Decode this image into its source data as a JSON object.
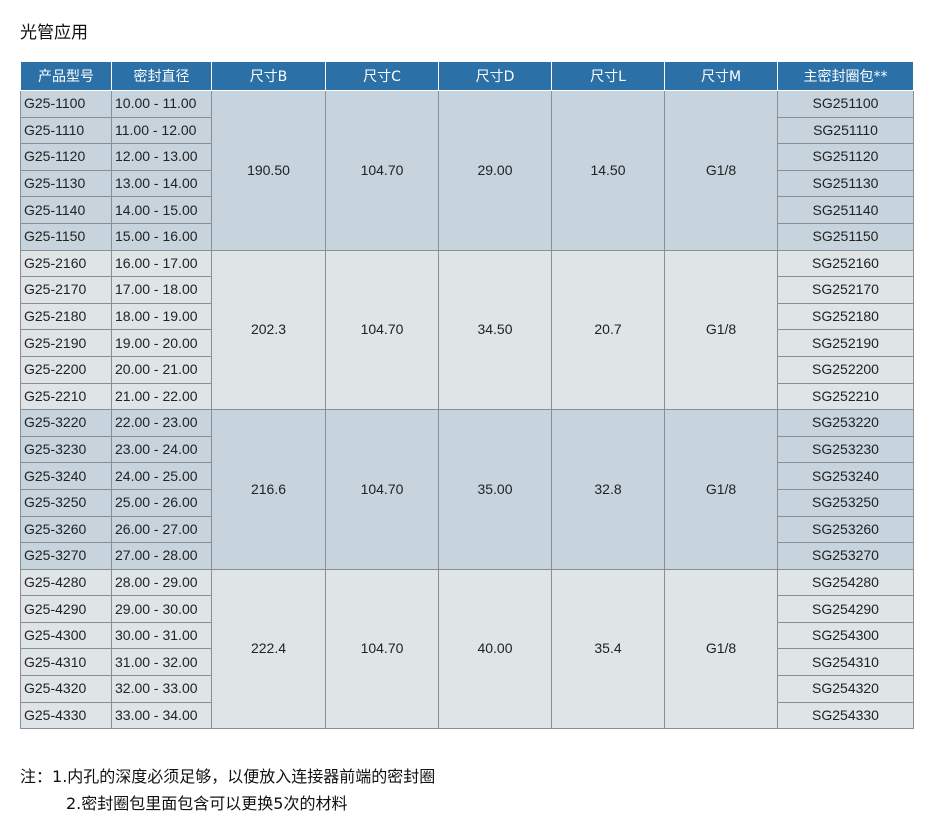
{
  "title": "光管应用",
  "headers": [
    "产品型号",
    "密封直径",
    "尺寸B",
    "尺寸C",
    "尺寸D",
    "尺寸L",
    "尺寸M",
    "主密封圈包**"
  ],
  "groups": [
    {
      "B": "190.50",
      "C": "104.70",
      "D": "29.00",
      "L": "14.50",
      "M": "G1/8",
      "rows": [
        {
          "model": "G25-1100",
          "range": "10.00 - 11.00",
          "seal": "SG251100"
        },
        {
          "model": "G25-1110",
          "range": "11.00 - 12.00",
          "seal": "SG251110"
        },
        {
          "model": "G25-1120",
          "range": "12.00 - 13.00",
          "seal": "SG251120"
        },
        {
          "model": "G25-1130",
          "range": "13.00 - 14.00",
          "seal": "SG251130"
        },
        {
          "model": "G25-1140",
          "range": "14.00 - 15.00",
          "seal": "SG251140"
        },
        {
          "model": "G25-1150",
          "range": "15.00 - 16.00",
          "seal": "SG251150"
        }
      ]
    },
    {
      "B": "202.3",
      "C": "104.70",
      "D": "34.50",
      "L": "20.7",
      "M": "G1/8",
      "rows": [
        {
          "model": "G25-2160",
          "range": "16.00 - 17.00",
          "seal": "SG252160"
        },
        {
          "model": "G25-2170",
          "range": "17.00 - 18.00",
          "seal": "SG252170"
        },
        {
          "model": "G25-2180",
          "range": "18.00 - 19.00",
          "seal": "SG252180"
        },
        {
          "model": "G25-2190",
          "range": "19.00 - 20.00",
          "seal": "SG252190"
        },
        {
          "model": "G25-2200",
          "range": "20.00 - 21.00",
          "seal": "SG252200"
        },
        {
          "model": "G25-2210",
          "range": "21.00 - 22.00",
          "seal": "SG252210"
        }
      ]
    },
    {
      "B": "216.6",
      "C": "104.70",
      "D": "35.00",
      "L": "32.8",
      "M": "G1/8",
      "rows": [
        {
          "model": "G25-3220",
          "range": "22.00 - 23.00",
          "seal": "SG253220"
        },
        {
          "model": "G25-3230",
          "range": "23.00 - 24.00",
          "seal": "SG253230"
        },
        {
          "model": "G25-3240",
          "range": "24.00 - 25.00",
          "seal": "SG253240"
        },
        {
          "model": "G25-3250",
          "range": "25.00 - 26.00",
          "seal": "SG253250"
        },
        {
          "model": "G25-3260",
          "range": "26.00 - 27.00",
          "seal": "SG253260"
        },
        {
          "model": "G25-3270",
          "range": "27.00 - 28.00",
          "seal": "SG253270"
        }
      ]
    },
    {
      "B": "222.4",
      "C": "104.70",
      "D": "40.00",
      "L": "35.4",
      "M": "G1/8",
      "rows": [
        {
          "model": "G25-4280",
          "range": "28.00 - 29.00",
          "seal": "SG254280"
        },
        {
          "model": "G25-4290",
          "range": "29.00 - 30.00",
          "seal": "SG254290"
        },
        {
          "model": "G25-4300",
          "range": "30.00 - 31.00",
          "seal": "SG254300"
        },
        {
          "model": "G25-4310",
          "range": "31.00 - 32.00",
          "seal": "SG254310"
        },
        {
          "model": "G25-4320",
          "range": "32.00 - 33.00",
          "seal": "SG254320"
        },
        {
          "model": "G25-4330",
          "range": "33.00 - 34.00",
          "seal": "SG254330"
        }
      ]
    }
  ],
  "notes": {
    "label": "注：",
    "items": [
      "1.内孔的深度必须足够，以便放入连接器前端的密封圈",
      "2.密封圈包里面包含可以更换5次的材料"
    ]
  },
  "colors": {
    "header_bg": "#2b71a8",
    "group_dark": "#c7d4dd",
    "group_light": "#dfe4e7"
  }
}
